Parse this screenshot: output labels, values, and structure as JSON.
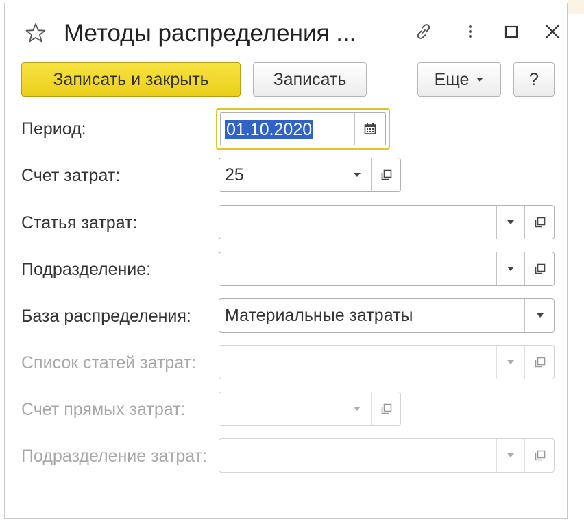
{
  "window": {
    "title": "Методы распределения ..."
  },
  "toolbar": {
    "save_close_label": "Записать и закрыть",
    "save_label": "Записать",
    "more_label": "Еще",
    "help_label": "?"
  },
  "form": {
    "period": {
      "label": "Период:",
      "value": "01.10.2020"
    },
    "cost_account": {
      "label": "Счет затрат:",
      "value": "25"
    },
    "cost_item": {
      "label": "Статья затрат:",
      "value": ""
    },
    "department": {
      "label": "Подразделение:",
      "value": ""
    },
    "allocation_base": {
      "label": "База распределения:",
      "value": "Материальные затраты"
    },
    "cost_items_list": {
      "label": "Список статей затрат:",
      "value": "",
      "disabled": true
    },
    "direct_cost_account": {
      "label": "Счет прямых затрат:",
      "value": "",
      "disabled": true
    },
    "cost_department": {
      "label": "Подразделение затрат:",
      "value": "",
      "disabled": true
    }
  },
  "colors": {
    "primary_button": "#f0d52a",
    "focus_border": "#e2c52e",
    "selection": "#2f63c8",
    "disabled_text": "#a8a8a8"
  }
}
